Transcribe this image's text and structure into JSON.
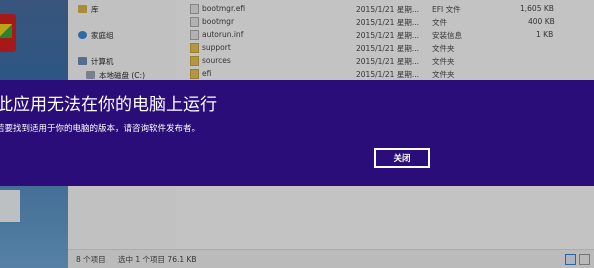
{
  "nav": {
    "library": "库",
    "homegroup": "家庭组",
    "computer": "计算机",
    "local_disk": "本地磁盘 (C:)"
  },
  "files": [
    {
      "name": "bootmgr.efi",
      "date": "2015/1/21 星期...",
      "type": "EFI 文件",
      "size": "1,605 KB",
      "icon": "file-icon"
    },
    {
      "name": "bootmgr",
      "date": "2015/1/21 星期...",
      "type": "文件",
      "size": "400 KB",
      "icon": "file-icon"
    },
    {
      "name": "autorun.inf",
      "date": "2015/1/21 星期...",
      "type": "安装信息",
      "size": "1 KB",
      "icon": "settings-file-icon"
    },
    {
      "name": "support",
      "date": "2015/1/21 星期...",
      "type": "文件夹",
      "size": "",
      "icon": "folder-icon"
    },
    {
      "name": "sources",
      "date": "2015/1/21 星期...",
      "type": "文件夹",
      "size": "",
      "icon": "folder-icon"
    },
    {
      "name": "efi",
      "date": "2015/1/21 星期...",
      "type": "文件夹",
      "size": "",
      "icon": "folder-icon"
    }
  ],
  "status": {
    "item_count": "8 个项目",
    "selection": "选中 1 个项目  76.1 KB"
  },
  "dialog": {
    "title": "此应用无法在你的电脑上运行",
    "message": "若要找到适用于你的电脑的版本，请咨询软件发布者。",
    "close_label": "关闭",
    "background": "#2a0d78"
  }
}
